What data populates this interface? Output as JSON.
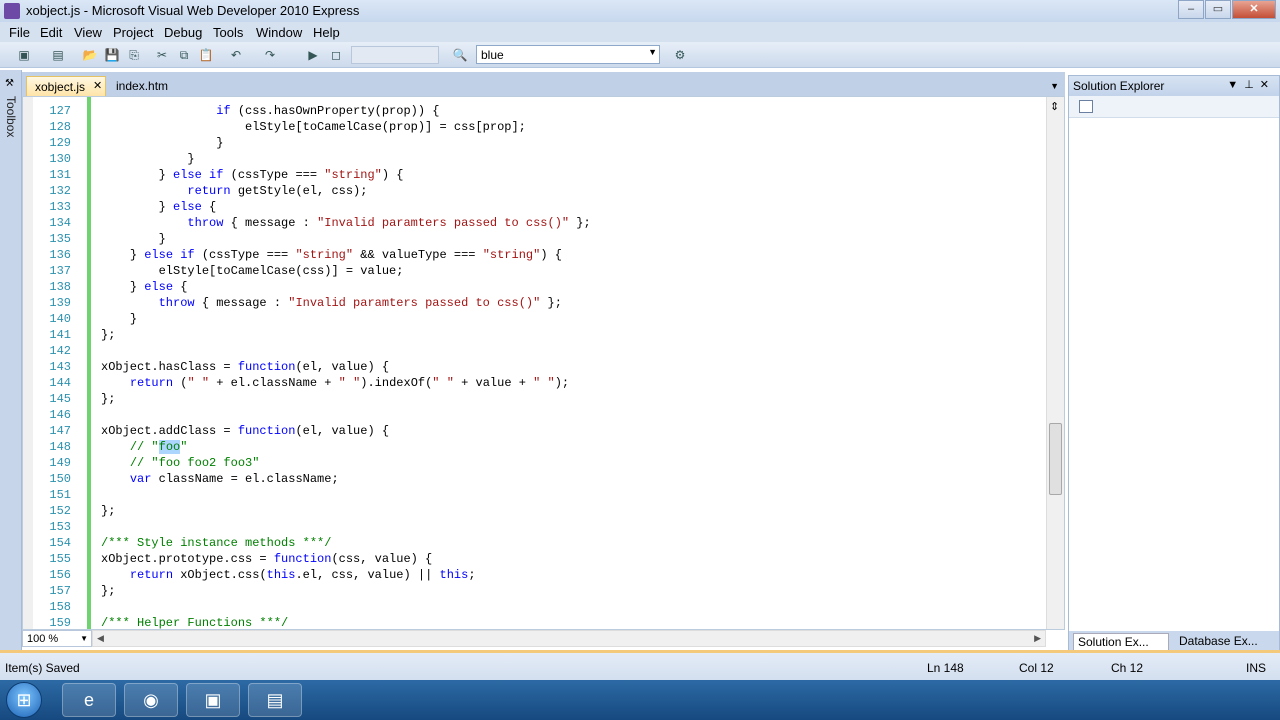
{
  "window": {
    "title": "xobject.js - Microsoft Visual Web Developer 2010 Express"
  },
  "menu": [
    "File",
    "Edit",
    "View",
    "Project",
    "Debug",
    "Tools",
    "Window",
    "Help"
  ],
  "toolbar": {
    "find_value": "blue"
  },
  "toolbox": {
    "label": "Toolbox"
  },
  "tabs": [
    {
      "label": "xobject.js",
      "active": true
    },
    {
      "label": "index.htm",
      "active": false
    }
  ],
  "editor": {
    "zoom": "100 %",
    "lines": [
      {
        "n": "127",
        "indent": "                ",
        "parts": [
          [
            "if (css.hasOwnProperty(prop)) {",
            "kw-if"
          ]
        ]
      },
      {
        "n": "128",
        "indent": "                    ",
        "parts": [
          [
            "elStyle[toCamelCase(prop)] = css[prop];",
            ""
          ]
        ]
      },
      {
        "n": "129",
        "indent": "                ",
        "parts": [
          [
            "}",
            ""
          ]
        ]
      },
      {
        "n": "130",
        "indent": "            ",
        "parts": [
          [
            "}",
            ""
          ]
        ]
      },
      {
        "n": "131",
        "indent": "        ",
        "parts": [
          [
            "} ",
            ""
          ],
          [
            "else if",
            "kw"
          ],
          [
            " (cssType === ",
            ""
          ],
          [
            "\"string\"",
            "str"
          ],
          [
            ") {",
            ""
          ]
        ]
      },
      {
        "n": "132",
        "indent": "            ",
        "parts": [
          [
            "return",
            "kw"
          ],
          [
            " getStyle(el, css);",
            ""
          ]
        ]
      },
      {
        "n": "133",
        "indent": "        ",
        "parts": [
          [
            "} ",
            ""
          ],
          [
            "else",
            "kw"
          ],
          [
            " {",
            ""
          ]
        ]
      },
      {
        "n": "134",
        "indent": "            ",
        "parts": [
          [
            "throw",
            "kw"
          ],
          [
            " { message : ",
            ""
          ],
          [
            "\"Invalid paramters passed to css()\"",
            "str"
          ],
          [
            " };",
            ""
          ]
        ]
      },
      {
        "n": "135",
        "indent": "        ",
        "parts": [
          [
            "}",
            ""
          ]
        ]
      },
      {
        "n": "136",
        "indent": "    ",
        "parts": [
          [
            "} ",
            ""
          ],
          [
            "else if",
            "kw"
          ],
          [
            " (cssType === ",
            ""
          ],
          [
            "\"string\"",
            "str"
          ],
          [
            " && valueType === ",
            ""
          ],
          [
            "\"string\"",
            "str"
          ],
          [
            ") {",
            ""
          ]
        ]
      },
      {
        "n": "137",
        "indent": "        ",
        "parts": [
          [
            "elStyle[toCamelCase(css)] = value;",
            ""
          ]
        ]
      },
      {
        "n": "138",
        "indent": "    ",
        "parts": [
          [
            "} ",
            ""
          ],
          [
            "else",
            "kw"
          ],
          [
            " {",
            ""
          ]
        ]
      },
      {
        "n": "139",
        "indent": "        ",
        "parts": [
          [
            "throw",
            "kw"
          ],
          [
            " { message : ",
            ""
          ],
          [
            "\"Invalid paramters passed to css()\"",
            "str"
          ],
          [
            " };",
            ""
          ]
        ]
      },
      {
        "n": "140",
        "indent": "    ",
        "parts": [
          [
            "}",
            ""
          ]
        ]
      },
      {
        "n": "141",
        "indent": "",
        "parts": [
          [
            "};",
            ""
          ]
        ]
      },
      {
        "n": "142",
        "indent": "",
        "parts": []
      },
      {
        "n": "143",
        "indent": "",
        "parts": [
          [
            "xObject.hasClass = ",
            ""
          ],
          [
            "function",
            "kw"
          ],
          [
            "(el, value) {",
            ""
          ]
        ]
      },
      {
        "n": "144",
        "indent": "    ",
        "parts": [
          [
            "return",
            "kw"
          ],
          [
            " (",
            ""
          ],
          [
            "\" \"",
            "str"
          ],
          [
            " + el.className + ",
            ""
          ],
          [
            "\" \"",
            "str"
          ],
          [
            ").indexOf(",
            ""
          ],
          [
            "\" \"",
            "str"
          ],
          [
            " + value + ",
            ""
          ],
          [
            "\" \"",
            "str"
          ],
          [
            ");",
            ""
          ]
        ]
      },
      {
        "n": "145",
        "indent": "",
        "parts": [
          [
            "};",
            ""
          ]
        ]
      },
      {
        "n": "146",
        "indent": "",
        "parts": []
      },
      {
        "n": "147",
        "indent": "",
        "parts": [
          [
            "xObject.addClass = ",
            ""
          ],
          [
            "function",
            "kw"
          ],
          [
            "(el, value) {",
            ""
          ]
        ]
      },
      {
        "n": "148",
        "indent": "    ",
        "parts": [
          [
            "// \"",
            "cm"
          ],
          [
            "foo",
            "cm sel"
          ],
          [
            "\"",
            "cm"
          ]
        ]
      },
      {
        "n": "149",
        "indent": "    ",
        "parts": [
          [
            "// \"foo foo2 foo3\"",
            "cm"
          ]
        ]
      },
      {
        "n": "150",
        "indent": "    ",
        "parts": [
          [
            "var",
            "kw"
          ],
          [
            " className = el.className;",
            ""
          ]
        ]
      },
      {
        "n": "151",
        "indent": "",
        "parts": []
      },
      {
        "n": "152",
        "indent": "",
        "parts": [
          [
            "};",
            ""
          ]
        ]
      },
      {
        "n": "153",
        "indent": "",
        "parts": []
      },
      {
        "n": "154",
        "indent": "",
        "parts": [
          [
            "/*** Style instance methods ***/",
            "cm"
          ]
        ]
      },
      {
        "n": "155",
        "indent": "",
        "parts": [
          [
            "xObject.prototype.css = ",
            ""
          ],
          [
            "function",
            "kw"
          ],
          [
            "(css, value) {",
            ""
          ]
        ]
      },
      {
        "n": "156",
        "indent": "    ",
        "parts": [
          [
            "return",
            "kw"
          ],
          [
            " xObject.css(",
            ""
          ],
          [
            "this",
            "kw"
          ],
          [
            ".el, css, value) || ",
            ""
          ],
          [
            "this",
            "kw"
          ],
          [
            ";",
            ""
          ]
        ]
      },
      {
        "n": "157",
        "indent": "",
        "parts": [
          [
            "};",
            ""
          ]
        ]
      },
      {
        "n": "158",
        "indent": "",
        "parts": []
      },
      {
        "n": "159",
        "indent": "",
        "parts": [
          [
            "/*** Helper Functions ***/",
            "cm"
          ]
        ]
      }
    ]
  },
  "solution_explorer": {
    "title": "Solution Explorer",
    "bottom_tabs": [
      "Solution Ex...",
      "Database Ex..."
    ]
  },
  "status": {
    "message": "Item(s) Saved",
    "ln": "Ln 148",
    "col": "Col 12",
    "ch": "Ch 12",
    "mode": "INS"
  }
}
